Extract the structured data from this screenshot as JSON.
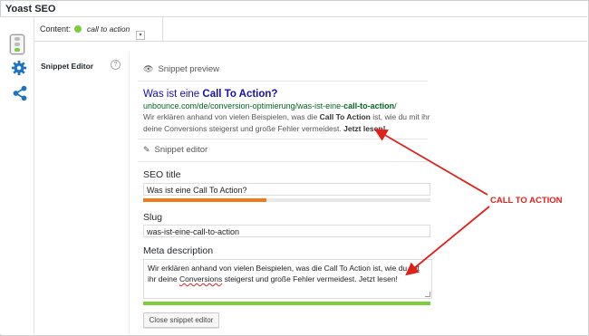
{
  "window": {
    "title": "Yoast SEO"
  },
  "tab": {
    "label": "Content:",
    "keyword": "call to action"
  },
  "sidebar": {
    "label": "Snippet Editor",
    "help": "?"
  },
  "preview": {
    "heading": "Snippet preview",
    "title_prefix": "Was ist eine ",
    "title_bold": "Call To Action?",
    "url_prefix": "unbounce.com/de/conversion-optimierung/was-ist-eine-",
    "url_bold": "call-to-action",
    "url_suffix": "/",
    "desc_1": "Wir erklären anhand von vielen Beispielen, was die ",
    "desc_bold": "Call To Action",
    "desc_2": " ist, wie du mit ihr deine Conversions steigerst und große Fehler vermeidest. ",
    "desc_bold_2": "Jetzt lesen!"
  },
  "editor": {
    "heading": "Snippet editor",
    "seo_title_label": "SEO title",
    "seo_title_value": "Was ist eine Call To Action?",
    "seo_title_progress": 0.43,
    "slug_label": "Slug",
    "slug_value": "was-ist-eine-call-to-action",
    "meta_label": "Meta description",
    "meta_text_1": "Wir erklären anhand von vielen Beispielen, was die Call To Action ist, wie du mit ihr deine ",
    "meta_misspelled": "Conversions",
    "meta_text_2": " steigerst und große Fehler vermeidest. Jetzt lesen!",
    "meta_progress": 1.0,
    "close_button": "Close snippet editor"
  },
  "annotation": {
    "label": "CALL TO ACTION"
  },
  "colors": {
    "good": "#7ad03a",
    "ok": "#ee7c1b",
    "annotation": "#e0201a",
    "link": "#1a0dab",
    "url": "#006621"
  },
  "icons": [
    "traffic-light-icon",
    "gear-icon",
    "share-icon",
    "eye-icon",
    "pencil-icon",
    "help-icon",
    "dropdown-icon"
  ]
}
